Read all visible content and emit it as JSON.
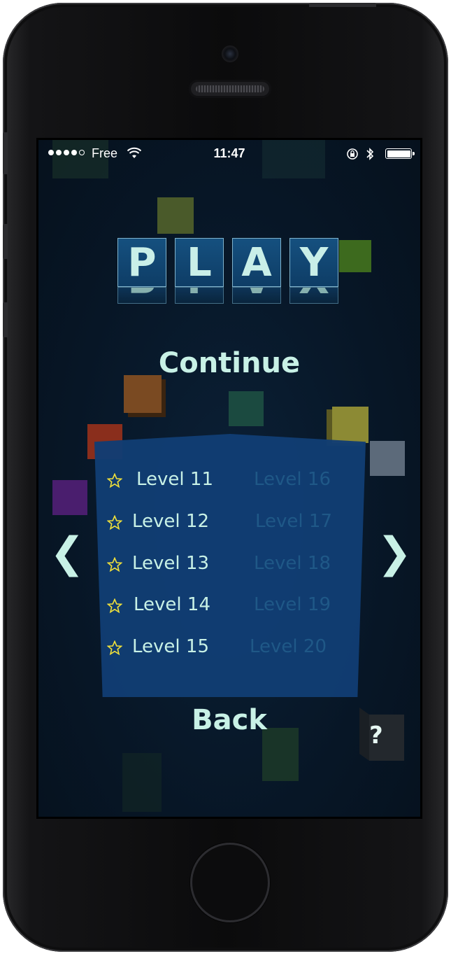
{
  "statusbar": {
    "carrier": "Free",
    "time": "11:47",
    "signal_icon": "signal-dots-icon",
    "wifi_icon": "wifi-icon",
    "lock_icon": "rotation-lock-icon",
    "bluetooth_icon": "bluetooth-icon",
    "battery_icon": "battery-icon"
  },
  "title": {
    "letters": [
      "P",
      "L",
      "A",
      "Y"
    ]
  },
  "menu": {
    "continue_label": "Continue",
    "back_label": "Back",
    "help_label": "?"
  },
  "levels": {
    "active": [
      "Level 11",
      "Level 12",
      "Level 13",
      "Level 14",
      "Level 15"
    ],
    "next_page": [
      "Level 16",
      "Level 17",
      "Level 18",
      "Level 19",
      "Level 20"
    ]
  },
  "navigation": {
    "prev_label": "❮",
    "next_label": "❯"
  },
  "colors": {
    "accent_text": "#c8f1e6",
    "panel": "#113d74",
    "star": "#f2e23a",
    "dim_text": "#1f5887"
  }
}
